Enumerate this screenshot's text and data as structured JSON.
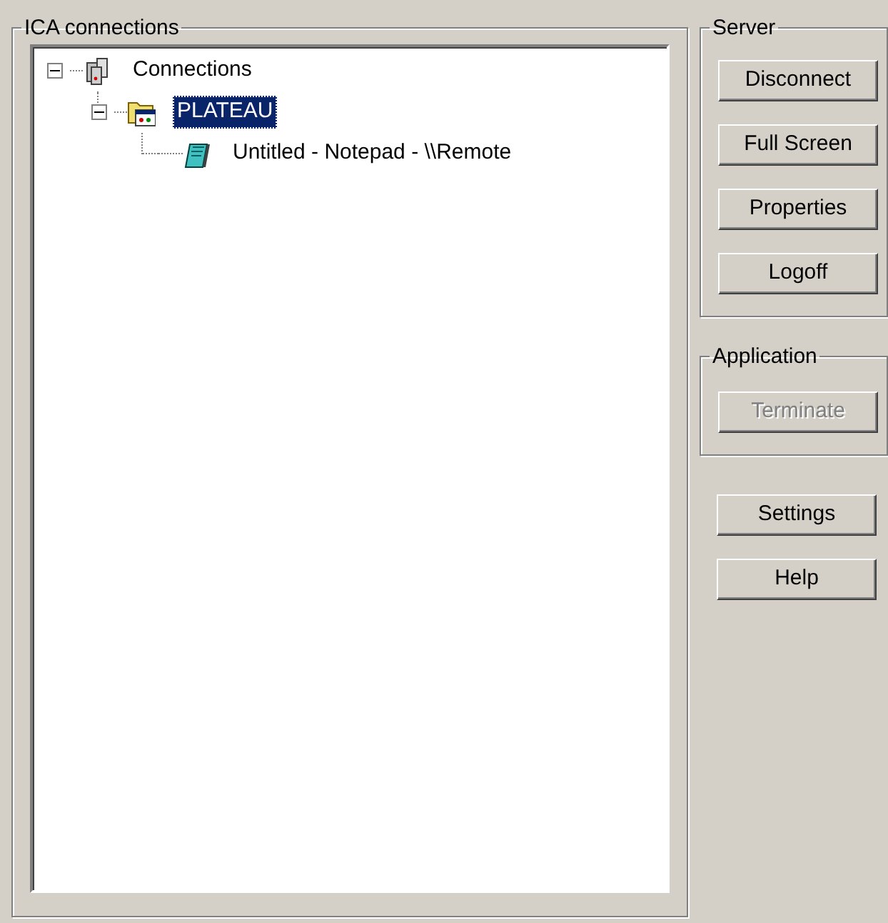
{
  "connections_group": {
    "title": "ICA connections"
  },
  "tree": [
    {
      "label": "Connections",
      "kind": "servers",
      "expanded": true,
      "selected": false,
      "children": [
        {
          "label": "PLATEAU",
          "kind": "folder",
          "expanded": true,
          "selected": true,
          "children": [
            {
              "label": "Untitled - Notepad - \\\\Remote",
              "kind": "notepad",
              "selected": false
            }
          ]
        }
      ]
    }
  ],
  "server_group": {
    "title": "Server",
    "buttons": [
      {
        "label": "Disconnect",
        "disabled": false
      },
      {
        "label": "Full Screen",
        "disabled": false
      },
      {
        "label": "Properties",
        "disabled": false
      },
      {
        "label": "Logoff",
        "disabled": false
      }
    ]
  },
  "application_group": {
    "title": "Application",
    "buttons": [
      {
        "label": "Terminate",
        "disabled": true
      }
    ]
  },
  "buttons": [
    {
      "label": "Settings",
      "disabled": false
    },
    {
      "label": "Help",
      "disabled": false
    }
  ]
}
